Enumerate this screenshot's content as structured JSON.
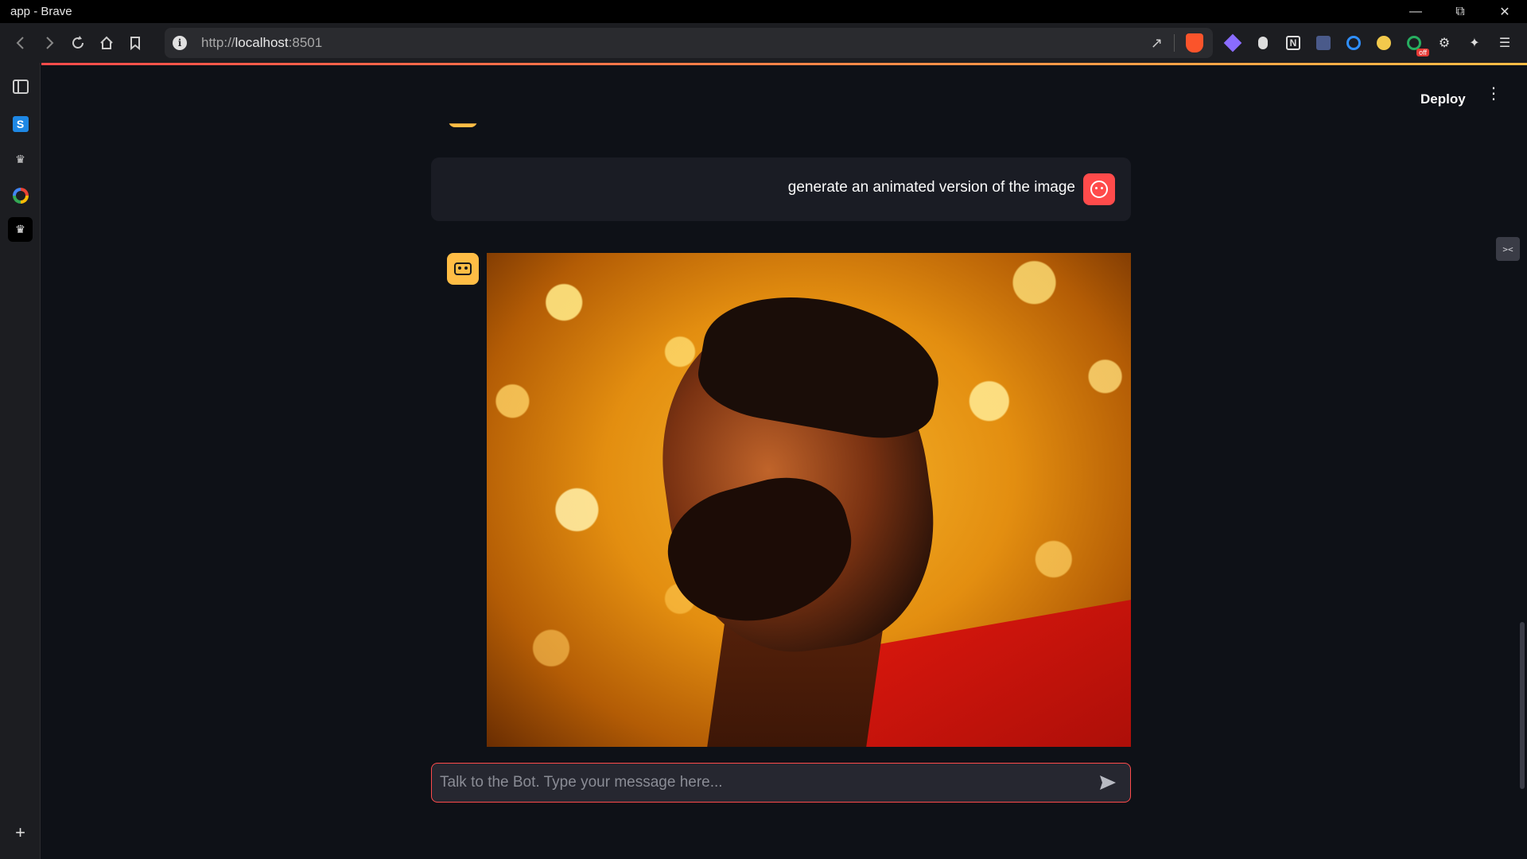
{
  "window": {
    "title": "app - Brave"
  },
  "browser": {
    "url_scheme": "http://",
    "url_host": "localhost",
    "url_port": ":8501",
    "extension_badge": "off"
  },
  "app": {
    "deploy_label": "Deploy",
    "user_message": "generate an animated version of the image",
    "chat_placeholder": "Talk to the Bot. Type your message here...",
    "chat_value": ""
  },
  "sidebar": {
    "items": [
      {
        "icon": "panel-icon"
      },
      {
        "icon": "s-app-icon",
        "glyph": "S"
      },
      {
        "icon": "crown-icon"
      },
      {
        "icon": "google-icon",
        "glyph": "G"
      },
      {
        "icon": "crown-active-icon"
      }
    ],
    "add_label": "+"
  },
  "colors": {
    "accent": "#ff4b4b",
    "bot_avatar": "#ffbd45",
    "background": "#0e1117",
    "message_bg": "#1a1c24",
    "input_bg": "#262730"
  }
}
